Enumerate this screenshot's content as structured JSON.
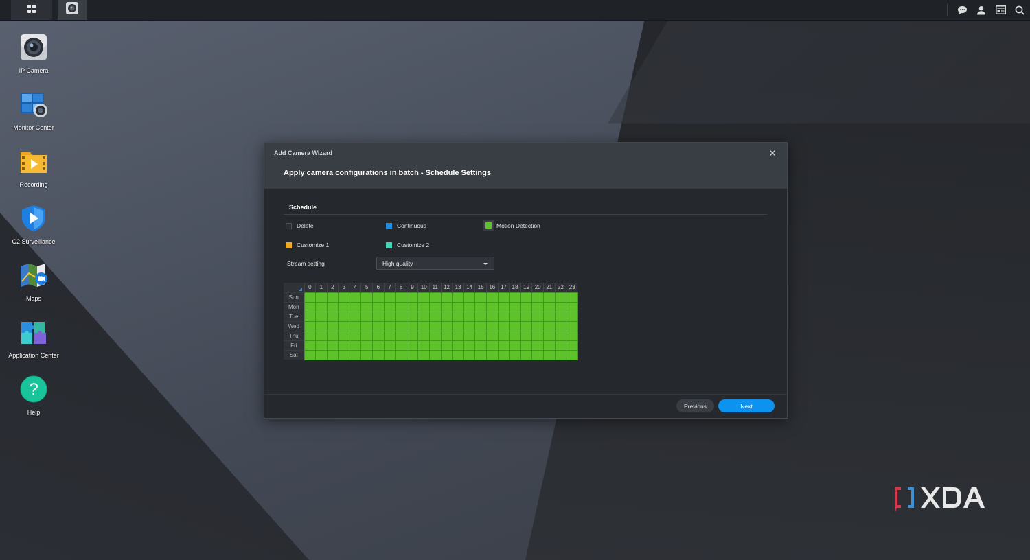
{
  "taskbar": {
    "main_menu_icon": "grid-icon",
    "active_app_icon": "ip-camera-icon",
    "right_icons": [
      "chat-icon",
      "user-icon",
      "widgets-icon",
      "search-icon"
    ]
  },
  "desktop": {
    "icons": [
      {
        "label": "IP Camera",
        "icon": "ip-camera-icon"
      },
      {
        "label": "Monitor Center",
        "icon": "monitor-center-icon"
      },
      {
        "label": "Recording",
        "icon": "recording-icon"
      },
      {
        "label": "C2 Surveillance",
        "icon": "c2-surveillance-icon"
      },
      {
        "label": "Maps",
        "icon": "maps-icon"
      },
      {
        "label": "Application Center",
        "icon": "application-center-icon"
      },
      {
        "label": "Help",
        "icon": "help-icon"
      }
    ]
  },
  "dialog": {
    "window_title": "Add Camera Wizard",
    "heading": "Apply camera configurations in batch - Schedule Settings",
    "section_title": "Schedule",
    "legend": {
      "delete": {
        "label": "Delete",
        "color": "#2a2d31"
      },
      "continuous": {
        "label": "Continuous",
        "color": "#1e8fe0"
      },
      "motion": {
        "label": "Motion Detection",
        "color": "#5ec22a"
      },
      "customize1": {
        "label": "Customize 1",
        "color": "#f0a820"
      },
      "customize2": {
        "label": "Customize 2",
        "color": "#3fd6b8"
      }
    },
    "stream_setting": {
      "label": "Stream setting",
      "value": "High quality"
    },
    "schedule": {
      "hours": [
        "0",
        "1",
        "2",
        "3",
        "4",
        "5",
        "6",
        "7",
        "8",
        "9",
        "10",
        "11",
        "12",
        "13",
        "14",
        "15",
        "16",
        "17",
        "18",
        "19",
        "20",
        "21",
        "22",
        "23"
      ],
      "days": [
        "Sun",
        "Mon",
        "Tue",
        "Wed",
        "Thu",
        "Fri",
        "Sat"
      ],
      "all_cells_mode": "Motion Detection"
    },
    "buttons": {
      "previous": "Previous",
      "next": "Next"
    }
  },
  "watermark": {
    "text": "XDA"
  }
}
